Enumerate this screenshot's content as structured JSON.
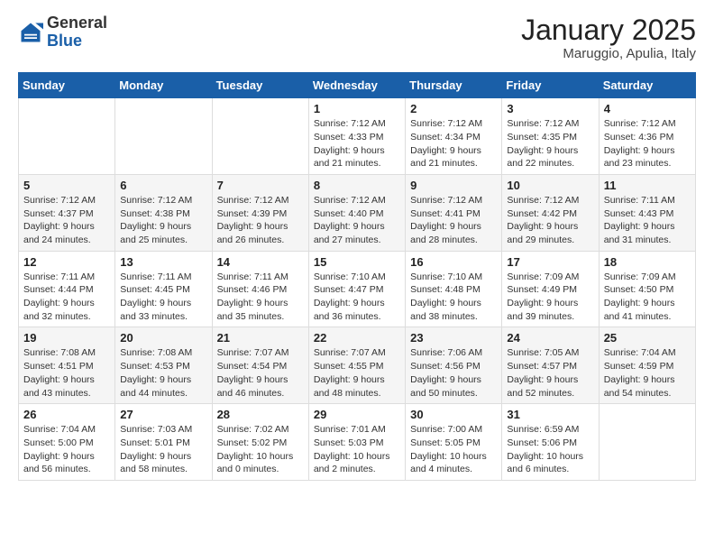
{
  "header": {
    "logo_general": "General",
    "logo_blue": "Blue",
    "month_title": "January 2025",
    "location": "Maruggio, Apulia, Italy"
  },
  "weekdays": [
    "Sunday",
    "Monday",
    "Tuesday",
    "Wednesday",
    "Thursday",
    "Friday",
    "Saturday"
  ],
  "weeks": [
    [
      {
        "day": "",
        "info": ""
      },
      {
        "day": "",
        "info": ""
      },
      {
        "day": "",
        "info": ""
      },
      {
        "day": "1",
        "info": "Sunrise: 7:12 AM\nSunset: 4:33 PM\nDaylight: 9 hours\nand 21 minutes."
      },
      {
        "day": "2",
        "info": "Sunrise: 7:12 AM\nSunset: 4:34 PM\nDaylight: 9 hours\nand 21 minutes."
      },
      {
        "day": "3",
        "info": "Sunrise: 7:12 AM\nSunset: 4:35 PM\nDaylight: 9 hours\nand 22 minutes."
      },
      {
        "day": "4",
        "info": "Sunrise: 7:12 AM\nSunset: 4:36 PM\nDaylight: 9 hours\nand 23 minutes."
      }
    ],
    [
      {
        "day": "5",
        "info": "Sunrise: 7:12 AM\nSunset: 4:37 PM\nDaylight: 9 hours\nand 24 minutes."
      },
      {
        "day": "6",
        "info": "Sunrise: 7:12 AM\nSunset: 4:38 PM\nDaylight: 9 hours\nand 25 minutes."
      },
      {
        "day": "7",
        "info": "Sunrise: 7:12 AM\nSunset: 4:39 PM\nDaylight: 9 hours\nand 26 minutes."
      },
      {
        "day": "8",
        "info": "Sunrise: 7:12 AM\nSunset: 4:40 PM\nDaylight: 9 hours\nand 27 minutes."
      },
      {
        "day": "9",
        "info": "Sunrise: 7:12 AM\nSunset: 4:41 PM\nDaylight: 9 hours\nand 28 minutes."
      },
      {
        "day": "10",
        "info": "Sunrise: 7:12 AM\nSunset: 4:42 PM\nDaylight: 9 hours\nand 29 minutes."
      },
      {
        "day": "11",
        "info": "Sunrise: 7:11 AM\nSunset: 4:43 PM\nDaylight: 9 hours\nand 31 minutes."
      }
    ],
    [
      {
        "day": "12",
        "info": "Sunrise: 7:11 AM\nSunset: 4:44 PM\nDaylight: 9 hours\nand 32 minutes."
      },
      {
        "day": "13",
        "info": "Sunrise: 7:11 AM\nSunset: 4:45 PM\nDaylight: 9 hours\nand 33 minutes."
      },
      {
        "day": "14",
        "info": "Sunrise: 7:11 AM\nSunset: 4:46 PM\nDaylight: 9 hours\nand 35 minutes."
      },
      {
        "day": "15",
        "info": "Sunrise: 7:10 AM\nSunset: 4:47 PM\nDaylight: 9 hours\nand 36 minutes."
      },
      {
        "day": "16",
        "info": "Sunrise: 7:10 AM\nSunset: 4:48 PM\nDaylight: 9 hours\nand 38 minutes."
      },
      {
        "day": "17",
        "info": "Sunrise: 7:09 AM\nSunset: 4:49 PM\nDaylight: 9 hours\nand 39 minutes."
      },
      {
        "day": "18",
        "info": "Sunrise: 7:09 AM\nSunset: 4:50 PM\nDaylight: 9 hours\nand 41 minutes."
      }
    ],
    [
      {
        "day": "19",
        "info": "Sunrise: 7:08 AM\nSunset: 4:51 PM\nDaylight: 9 hours\nand 43 minutes."
      },
      {
        "day": "20",
        "info": "Sunrise: 7:08 AM\nSunset: 4:53 PM\nDaylight: 9 hours\nand 44 minutes."
      },
      {
        "day": "21",
        "info": "Sunrise: 7:07 AM\nSunset: 4:54 PM\nDaylight: 9 hours\nand 46 minutes."
      },
      {
        "day": "22",
        "info": "Sunrise: 7:07 AM\nSunset: 4:55 PM\nDaylight: 9 hours\nand 48 minutes."
      },
      {
        "day": "23",
        "info": "Sunrise: 7:06 AM\nSunset: 4:56 PM\nDaylight: 9 hours\nand 50 minutes."
      },
      {
        "day": "24",
        "info": "Sunrise: 7:05 AM\nSunset: 4:57 PM\nDaylight: 9 hours\nand 52 minutes."
      },
      {
        "day": "25",
        "info": "Sunrise: 7:04 AM\nSunset: 4:59 PM\nDaylight: 9 hours\nand 54 minutes."
      }
    ],
    [
      {
        "day": "26",
        "info": "Sunrise: 7:04 AM\nSunset: 5:00 PM\nDaylight: 9 hours\nand 56 minutes."
      },
      {
        "day": "27",
        "info": "Sunrise: 7:03 AM\nSunset: 5:01 PM\nDaylight: 9 hours\nand 58 minutes."
      },
      {
        "day": "28",
        "info": "Sunrise: 7:02 AM\nSunset: 5:02 PM\nDaylight: 10 hours\nand 0 minutes."
      },
      {
        "day": "29",
        "info": "Sunrise: 7:01 AM\nSunset: 5:03 PM\nDaylight: 10 hours\nand 2 minutes."
      },
      {
        "day": "30",
        "info": "Sunrise: 7:00 AM\nSunset: 5:05 PM\nDaylight: 10 hours\nand 4 minutes."
      },
      {
        "day": "31",
        "info": "Sunrise: 6:59 AM\nSunset: 5:06 PM\nDaylight: 10 hours\nand 6 minutes."
      },
      {
        "day": "",
        "info": ""
      }
    ]
  ]
}
